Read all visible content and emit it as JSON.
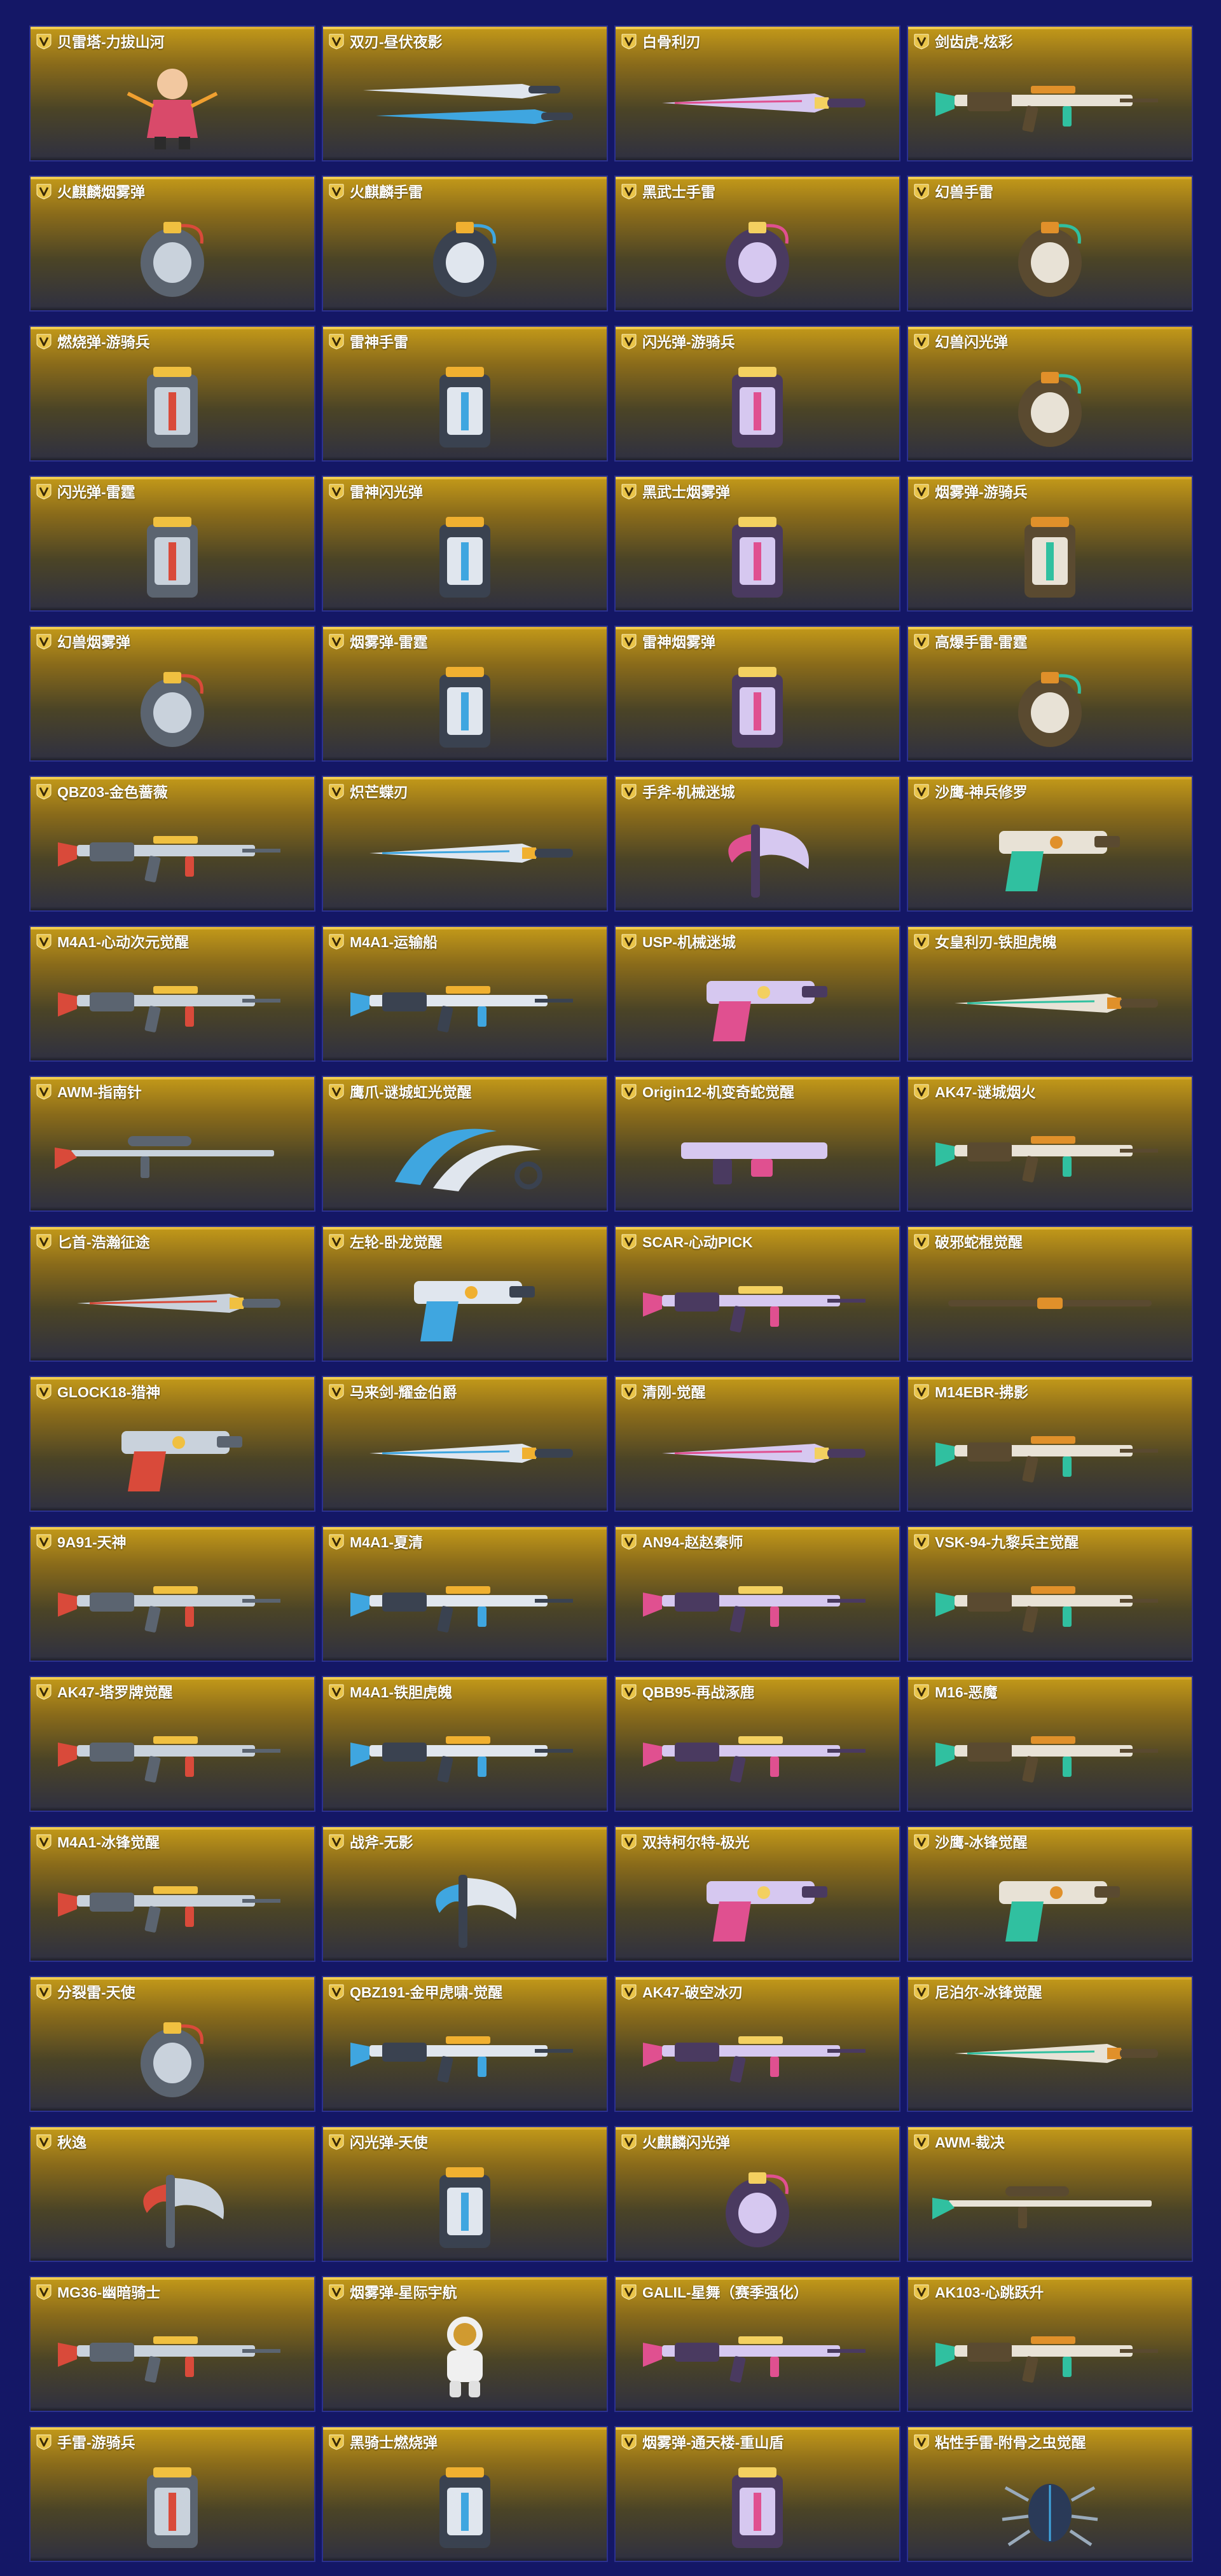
{
  "items": [
    {
      "name": "贝雷塔-力拔山河",
      "icon": "character-icon"
    },
    {
      "name": "双刃-昼伏夜影",
      "icon": "dual-blade-icon"
    },
    {
      "name": "白骨利刃",
      "icon": "blade-icon"
    },
    {
      "name": "剑齿虎-炫彩",
      "icon": "rifle-icon"
    },
    {
      "name": "火麒麟烟雾弹",
      "icon": "grenade-icon"
    },
    {
      "name": "火麒麟手雷",
      "icon": "grenade-icon"
    },
    {
      "name": "黑武士手雷",
      "icon": "grenade-icon"
    },
    {
      "name": "幻兽手雷",
      "icon": "grenade-icon"
    },
    {
      "name": "燃烧弹-游骑兵",
      "icon": "canister-icon"
    },
    {
      "name": "雷神手雷",
      "icon": "canister-icon"
    },
    {
      "name": "闪光弹-游骑兵",
      "icon": "canister-icon"
    },
    {
      "name": "幻兽闪光弹",
      "icon": "grenade-icon"
    },
    {
      "name": "闪光弹-雷霆",
      "icon": "canister-icon"
    },
    {
      "name": "雷神闪光弹",
      "icon": "canister-icon"
    },
    {
      "name": "黑武士烟雾弹",
      "icon": "canister-icon"
    },
    {
      "name": "烟雾弹-游骑兵",
      "icon": "canister-icon"
    },
    {
      "name": "幻兽烟雾弹",
      "icon": "grenade-icon"
    },
    {
      "name": "烟雾弹-雷霆",
      "icon": "canister-icon"
    },
    {
      "name": "雷神烟雾弹",
      "icon": "canister-icon"
    },
    {
      "name": "高爆手雷-雷霆",
      "icon": "grenade-icon"
    },
    {
      "name": "QBZ03-金色蔷薇",
      "icon": "rifle-icon"
    },
    {
      "name": "炽芒蝶刃",
      "icon": "blade-icon"
    },
    {
      "name": "手斧-机械迷城",
      "icon": "axe-icon"
    },
    {
      "name": "沙鹰-神兵修罗",
      "icon": "pistol-icon"
    },
    {
      "name": "M4A1-心动次元觉醒",
      "icon": "rifle-icon"
    },
    {
      "name": "M4A1-运输船",
      "icon": "rifle-icon"
    },
    {
      "name": "USP-机械迷城",
      "icon": "pistol-icon"
    },
    {
      "name": "女皇利刃-铁胆虎魄",
      "icon": "blade-icon"
    },
    {
      "name": "AWM-指南针",
      "icon": "sniper-icon"
    },
    {
      "name": "鹰爪-谜城虹光觉醒",
      "icon": "claw-knife-icon"
    },
    {
      "name": "Origin12-机变奇蛇觉醒",
      "icon": "shotgun-icon"
    },
    {
      "name": "AK47-谜城烟火",
      "icon": "rifle-icon"
    },
    {
      "name": "匕首-浩瀚征途",
      "icon": "dagger-icon"
    },
    {
      "name": "左轮-卧龙觉醒",
      "icon": "revolver-icon"
    },
    {
      "name": "SCAR-心动PICK",
      "icon": "rifle-icon"
    },
    {
      "name": "破邪蛇棍觉醒",
      "icon": "staff-icon"
    },
    {
      "name": "GLOCK18-猎神",
      "icon": "pistol-icon"
    },
    {
      "name": "马来剑-耀金伯爵",
      "icon": "blade-icon"
    },
    {
      "name": "清刚-觉醒",
      "icon": "knife-icon"
    },
    {
      "name": "M14EBR-拂影",
      "icon": "rifle-icon"
    },
    {
      "name": "9A91-天神",
      "icon": "rifle-icon"
    },
    {
      "name": "M4A1-夏清",
      "icon": "rifle-icon"
    },
    {
      "name": "AN94-赵赵秦师",
      "icon": "rifle-icon"
    },
    {
      "name": "VSK-94-九黎兵主觉醒",
      "icon": "rifle-icon"
    },
    {
      "name": "AK47-塔罗牌觉醒",
      "icon": "rifle-icon"
    },
    {
      "name": "M4A1-铁胆虎魄",
      "icon": "rifle-icon"
    },
    {
      "name": "QBB95-再战涿鹿",
      "icon": "rifle-icon"
    },
    {
      "name": "M16-恶魔",
      "icon": "rifle-icon"
    },
    {
      "name": "M4A1-冰锋觉醒",
      "icon": "rifle-icon"
    },
    {
      "name": "战斧-无影",
      "icon": "axe-icon"
    },
    {
      "name": "双持柯尔特-极光",
      "icon": "pistol-icon"
    },
    {
      "name": "沙鹰-冰锋觉醒",
      "icon": "pistol-icon"
    },
    {
      "name": "分裂雷-天使",
      "icon": "grenade-icon"
    },
    {
      "name": "QBZ191-金甲虎啸-觉醒",
      "icon": "rifle-icon"
    },
    {
      "name": "AK47-破空冰刃",
      "icon": "rifle-icon"
    },
    {
      "name": "尼泊尔-冰锋觉醒",
      "icon": "blade-icon"
    },
    {
      "name": "秋逸",
      "icon": "axe-icon"
    },
    {
      "name": "闪光弹-天使",
      "icon": "canister-icon"
    },
    {
      "name": "火麒麟闪光弹",
      "icon": "grenade-icon"
    },
    {
      "name": "AWM-裁决",
      "icon": "sniper-icon"
    },
    {
      "name": "MG36-幽暗骑士",
      "icon": "rifle-icon"
    },
    {
      "name": "烟雾弹-星际宇航",
      "icon": "astronaut-icon"
    },
    {
      "name": "GALIL-星舞（赛季强化）",
      "icon": "rifle-icon"
    },
    {
      "name": "AK103-心跳跃升",
      "icon": "rifle-icon"
    },
    {
      "name": "手雷-游骑兵",
      "icon": "canister-icon"
    },
    {
      "name": "黑骑士燃烧弹",
      "icon": "canister-icon"
    },
    {
      "name": "烟雾弹-通天楼-重山盾",
      "icon": "canister-icon"
    },
    {
      "name": "粘性手雷-附骨之虫觉醒",
      "icon": "beetle-icon"
    }
  ],
  "colors": {
    "background": "#141766",
    "card_top": "#c49a19",
    "card_bottom": "#2f3041",
    "badge": "#e9c449"
  }
}
